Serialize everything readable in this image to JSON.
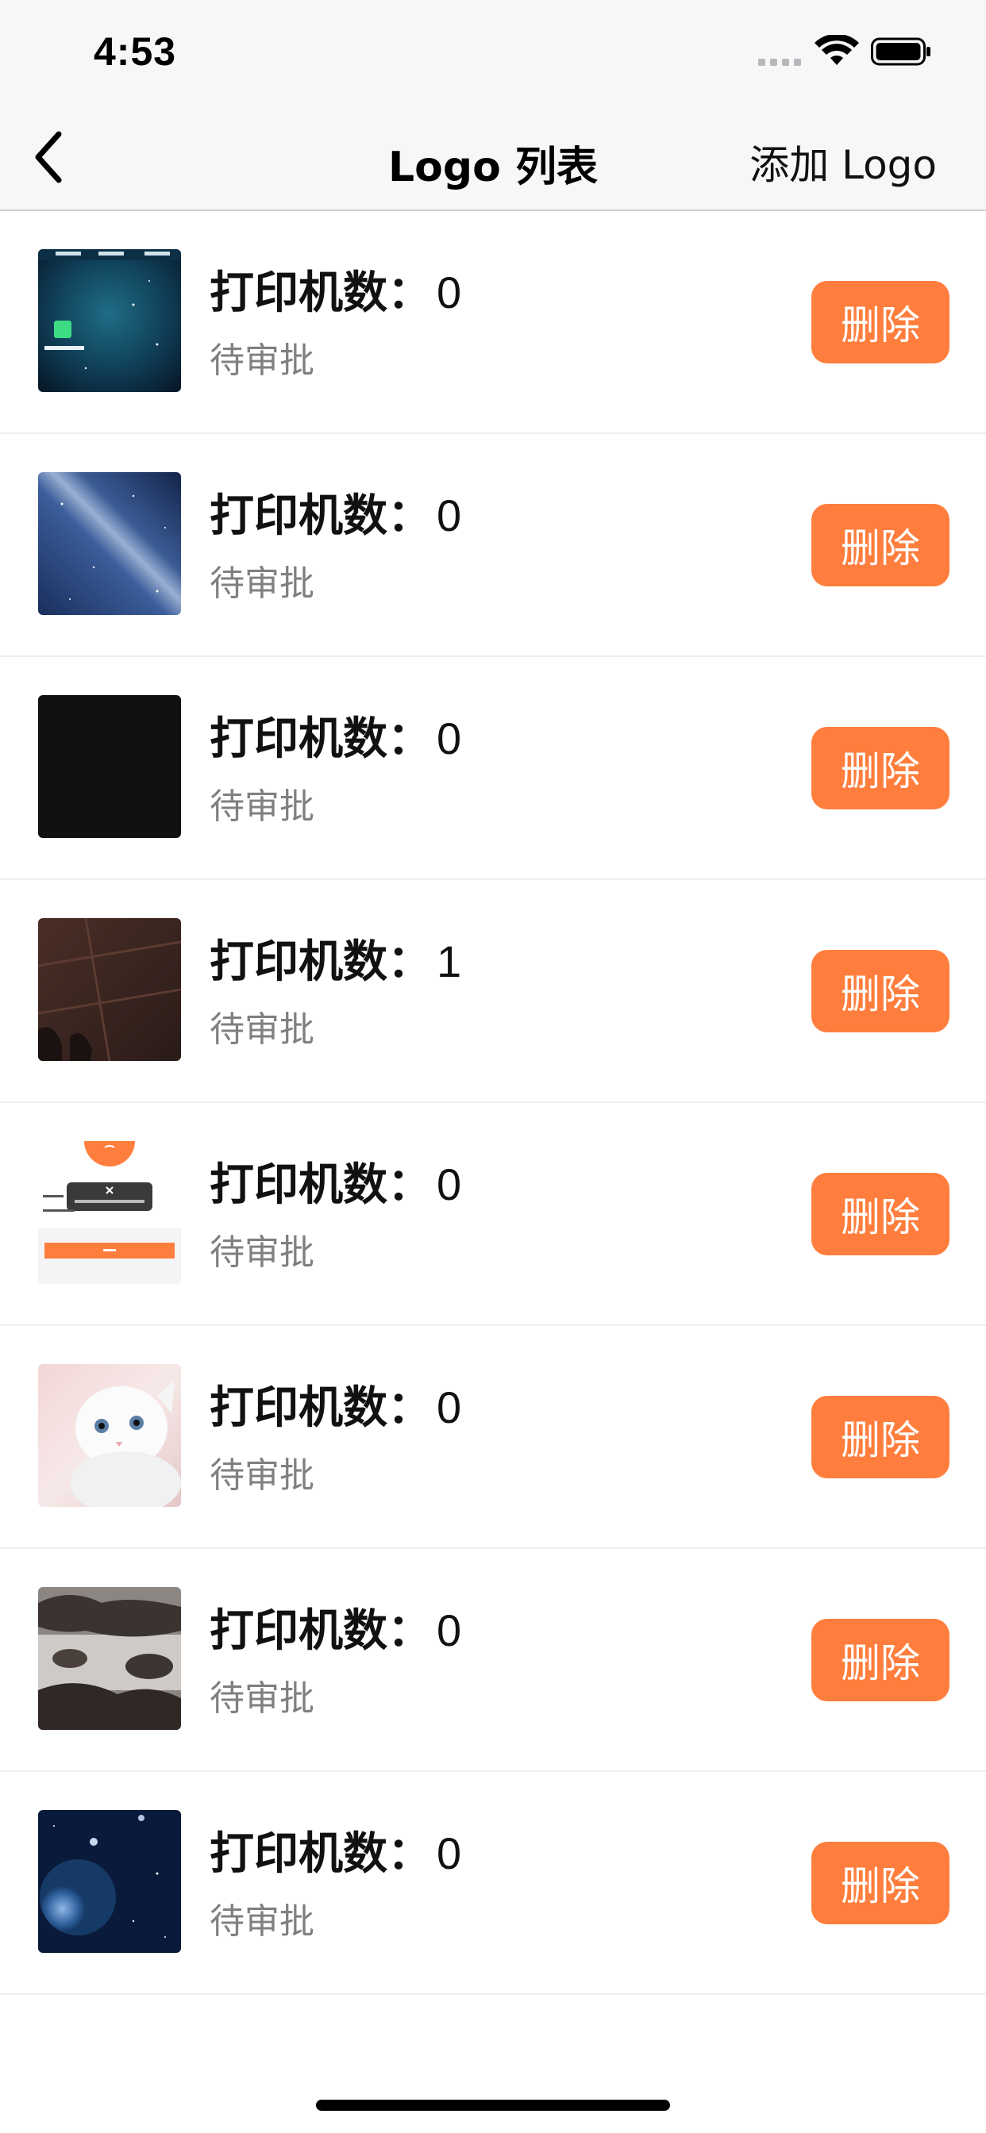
{
  "status_bar": {
    "time": "4:53"
  },
  "nav": {
    "title": "Logo 列表",
    "add_label": "添加 Logo"
  },
  "items": [
    {
      "thumbnail": "android-app-screenshot-thumbnail",
      "count_label": "打印机数：",
      "count": "0",
      "status": "待审批",
      "delete_label": "删除"
    },
    {
      "thumbnail": "milky-way-thumbnail",
      "count_label": "打印机数：",
      "count": "0",
      "status": "待审批",
      "delete_label": "删除"
    },
    {
      "thumbnail": "black-square-thumbnail",
      "count_label": "打印机数：",
      "count": "0",
      "status": "待审批",
      "delete_label": "删除"
    },
    {
      "thumbnail": "floor-feet-photo-thumbnail",
      "count_label": "打印机数：",
      "count": "1",
      "status": "待审批",
      "delete_label": "删除"
    },
    {
      "thumbnail": "app-dialog-screenshot-thumbnail",
      "count_label": "打印机数：",
      "count": "0",
      "status": "待审批",
      "delete_label": "删除"
    },
    {
      "thumbnail": "white-kitten-thumbnail",
      "count_label": "打印机数：",
      "count": "0",
      "status": "待审批",
      "delete_label": "删除"
    },
    {
      "thumbnail": "rocks-water-thumbnail",
      "count_label": "打印机数：",
      "count": "0",
      "status": "待审批",
      "delete_label": "删除"
    },
    {
      "thumbnail": "planet-space-thumbnail",
      "count_label": "打印机数：",
      "count": "0",
      "status": "待审批",
      "delete_label": "删除"
    }
  ],
  "colors": {
    "accent": "#ff7e3d",
    "secondary_text": "#808080",
    "nav_background": "#f7f7f8"
  }
}
